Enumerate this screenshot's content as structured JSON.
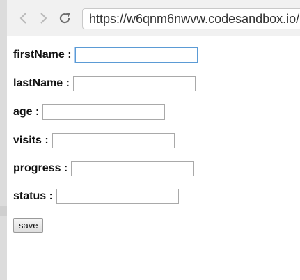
{
  "browser": {
    "url": "https://w6qnm6nwvw.codesandbox.io/"
  },
  "form": {
    "fields": [
      {
        "label": "firstName :",
        "value": ""
      },
      {
        "label": "lastName :",
        "value": ""
      },
      {
        "label": "age :",
        "value": ""
      },
      {
        "label": "visits :",
        "value": ""
      },
      {
        "label": "progress :",
        "value": ""
      },
      {
        "label": "status :",
        "value": ""
      }
    ],
    "save_label": "save"
  },
  "icons": {
    "back": "back-arrow-icon",
    "forward": "forward-arrow-icon",
    "reload": "reload-icon"
  },
  "colors": {
    "toolbar": "#f1f1f1",
    "focus_border": "#5b9bd5"
  }
}
